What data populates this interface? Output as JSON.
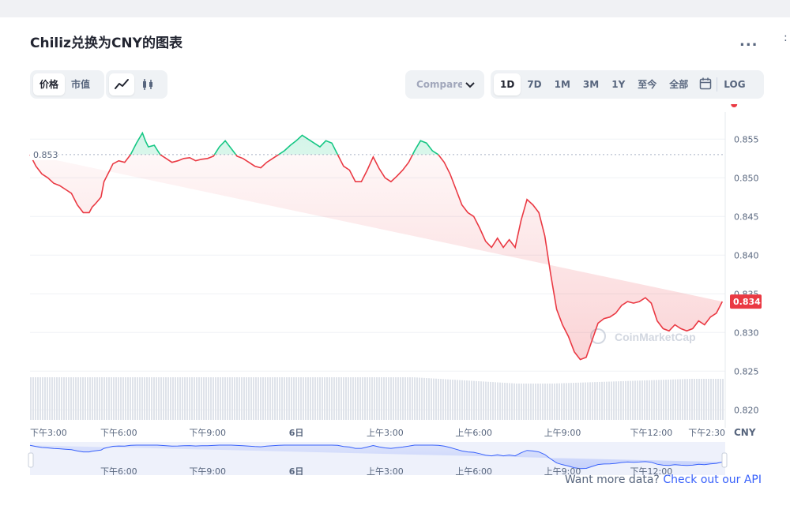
{
  "header": {
    "title": "Chiliz兑换为CNY的图表",
    "more_label": "..."
  },
  "toolbar": {
    "type_tabs": [
      {
        "label": "价格",
        "active": true
      },
      {
        "label": "市值",
        "active": false
      }
    ],
    "style_icons": [
      {
        "icon": "line-chart-icon",
        "active": true
      },
      {
        "icon": "candlestick-icon",
        "active": false
      }
    ],
    "compare_label": "Compare with",
    "ranges": [
      {
        "label": "1D",
        "active": true
      },
      {
        "label": "7D",
        "active": false
      },
      {
        "label": "1M",
        "active": false
      },
      {
        "label": "3M",
        "active": false
      },
      {
        "label": "1Y",
        "active": false
      },
      {
        "label": "至今",
        "active": false
      },
      {
        "label": "全部",
        "active": false
      }
    ],
    "calendar_icon": "calendar-icon",
    "log_label": "LOG"
  },
  "footer": {
    "text": "Want more data?",
    "link": "Check out our API"
  },
  "chart_data": {
    "type": "line",
    "currency_label": "CNY",
    "watermark": "CoinMarketCap",
    "open_price": 0.853,
    "open_price_label": "0.853",
    "last_price": 0.834,
    "last_price_label": "0.834",
    "y_ticks": [
      "0.855",
      "0.850",
      "0.845",
      "0.840",
      "0.835",
      "0.830",
      "0.825",
      "0.820"
    ],
    "ylim": [
      0.8185,
      0.8585
    ],
    "x_ticks": [
      "下午3:00",
      "下午6:00",
      "下午9:00",
      "6日",
      "上午3:00",
      "上午6:00",
      "上午9:00",
      "下午12:00",
      "下午2:30"
    ],
    "x_tick_hours": [
      0,
      3,
      6,
      9,
      12,
      15,
      18,
      21,
      23.5
    ],
    "navigator_ticks": [
      "下午6:00",
      "下午9:00",
      "6日",
      "上午3:00",
      "上午6:00",
      "上午9:00",
      "下午12:00"
    ],
    "navigator_tick_hours": [
      3,
      6,
      9,
      12,
      15,
      18,
      21
    ],
    "colors": {
      "up": "#16c784",
      "down": "#ea3943",
      "navigator": "#3861fb"
    },
    "x": [
      0,
      0.2,
      0.4,
      0.6,
      0.8,
      1.0,
      1.2,
      1.4,
      1.6,
      1.8,
      2.0,
      2.1,
      2.2,
      2.4,
      2.5,
      2.7,
      2.8,
      3.0,
      3.2,
      3.4,
      3.6,
      3.8,
      3.9,
      4.0,
      4.2,
      4.3,
      4.4,
      4.6,
      4.8,
      5.0,
      5.2,
      5.4,
      5.6,
      5.8,
      6.0,
      6.2,
      6.4,
      6.6,
      6.8,
      7.0,
      7.2,
      7.4,
      7.6,
      7.8,
      8.0,
      8.2,
      8.4,
      8.6,
      8.8,
      9.0,
      9.2,
      9.4,
      9.6,
      9.8,
      10.0,
      10.2,
      10.4,
      10.6,
      10.8,
      11.0,
      11.2,
      11.4,
      11.6,
      11.8,
      12.0,
      12.2,
      12.4,
      12.6,
      12.8,
      13.0,
      13.2,
      13.4,
      13.6,
      13.8,
      14.0,
      14.2,
      14.4,
      14.6,
      14.8,
      15.0,
      15.2,
      15.4,
      15.6,
      15.8,
      16.0,
      16.2,
      16.4,
      16.6,
      16.8,
      17.0,
      17.2,
      17.4,
      17.6,
      17.8,
      18.0,
      18.2,
      18.4,
      18.6,
      18.8,
      19.0,
      19.2,
      19.4,
      19.6,
      19.8,
      20.0,
      20.2,
      20.4,
      20.6,
      20.8,
      21.0,
      21.2,
      21.4,
      21.6,
      21.8,
      22.0,
      22.2,
      22.4,
      22.6,
      22.8,
      23.0,
      23.2,
      23.4,
      23.6,
      23.8
    ],
    "y": [
      0.853,
      0.8515,
      0.8505,
      0.85,
      0.8493,
      0.849,
      0.8485,
      0.848,
      0.8465,
      0.8455,
      0.8455,
      0.8462,
      0.8466,
      0.8475,
      0.8495,
      0.851,
      0.8518,
      0.8522,
      0.852,
      0.853,
      0.8545,
      0.8558,
      0.8548,
      0.854,
      0.8542,
      0.8536,
      0.853,
      0.8525,
      0.852,
      0.8522,
      0.8525,
      0.8526,
      0.8522,
      0.8524,
      0.8525,
      0.8528,
      0.854,
      0.8548,
      0.8538,
      0.8528,
      0.8525,
      0.852,
      0.8515,
      0.8513,
      0.852,
      0.8525,
      0.853,
      0.8535,
      0.8542,
      0.8548,
      0.8555,
      0.855,
      0.8545,
      0.854,
      0.8548,
      0.8545,
      0.853,
      0.8515,
      0.851,
      0.8495,
      0.8495,
      0.851,
      0.8527,
      0.8512,
      0.85,
      0.8495,
      0.8502,
      0.851,
      0.852,
      0.8535,
      0.8548,
      0.8545,
      0.8535,
      0.853,
      0.852,
      0.8505,
      0.8485,
      0.8465,
      0.8455,
      0.845,
      0.8435,
      0.8418,
      0.841,
      0.8422,
      0.841,
      0.842,
      0.841,
      0.8445,
      0.8472,
      0.8465,
      0.8455,
      0.8425,
      0.8375,
      0.833,
      0.831,
      0.8295,
      0.8275,
      0.8265,
      0.8268,
      0.829,
      0.8312,
      0.8318,
      0.832,
      0.8325,
      0.8335,
      0.834,
      0.8338,
      0.834,
      0.8345,
      0.8338,
      0.8315,
      0.8305,
      0.8302,
      0.831,
      0.8305,
      0.8302,
      0.8305,
      0.8315,
      0.831,
      0.832,
      0.8325,
      0.834
    ]
  }
}
